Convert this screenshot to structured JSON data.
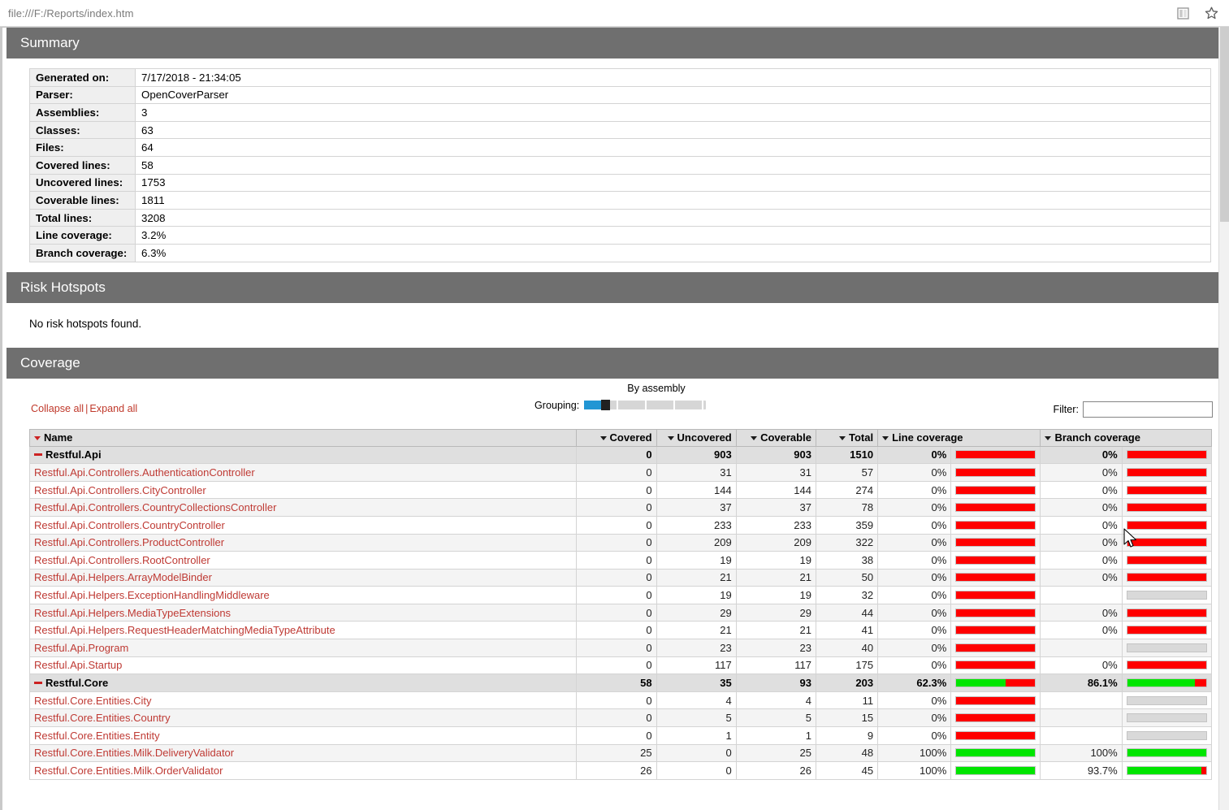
{
  "browser": {
    "url": "file:///F:/Reports/index.htm",
    "icons": [
      {
        "name": "reading-view-icon",
        "label": "Reading view"
      },
      {
        "name": "favorites-star-icon",
        "label": "Add to favorites"
      }
    ]
  },
  "sections": {
    "summary_title": "Summary",
    "risk_title": "Risk Hotspots",
    "coverage_title": "Coverage"
  },
  "summary": {
    "rows": [
      {
        "label": "Generated on:",
        "value": "7/17/2018 - 21:34:05"
      },
      {
        "label": "Parser:",
        "value": "OpenCoverParser"
      },
      {
        "label": "Assemblies:",
        "value": "3"
      },
      {
        "label": "Classes:",
        "value": "63"
      },
      {
        "label": "Files:",
        "value": "64"
      },
      {
        "label": "Covered lines:",
        "value": "58"
      },
      {
        "label": "Uncovered lines:",
        "value": "1753"
      },
      {
        "label": "Coverable lines:",
        "value": "1811"
      },
      {
        "label": "Total lines:",
        "value": "3208"
      },
      {
        "label": "Line coverage:",
        "value": "3.2%"
      },
      {
        "label": "Branch coverage:",
        "value": "6.3%"
      }
    ]
  },
  "risk_hotspots": {
    "message": "No risk hotspots found."
  },
  "coverage_controls": {
    "collapse_all": "Collapse all",
    "separator": "|",
    "expand_all": "Expand all",
    "grouping_title": "By assembly",
    "grouping_label": "Grouping:",
    "grouping_value": 1,
    "filter_label": "Filter:",
    "filter_value": "",
    "filter_placeholder": ""
  },
  "coverage_table": {
    "headers": {
      "name": "Name",
      "covered": "Covered",
      "uncovered": "Uncovered",
      "coverable": "Coverable",
      "total": "Total",
      "line_coverage": "Line coverage",
      "branch_coverage": "Branch coverage"
    },
    "rows": [
      {
        "type": "group",
        "name": "Restful.Api",
        "covered": "0",
        "uncovered": "903",
        "coverable": "903",
        "total": "1510",
        "line_pct": "0%",
        "line_val": 0,
        "branch_pct": "0%",
        "branch_val": 0
      },
      {
        "type": "item",
        "name": "Restful.Api.Controllers.AuthenticationController",
        "covered": "0",
        "uncovered": "31",
        "coverable": "31",
        "total": "57",
        "line_pct": "0%",
        "line_val": 0,
        "branch_pct": "0%",
        "branch_val": 0
      },
      {
        "type": "item",
        "name": "Restful.Api.Controllers.CityController",
        "covered": "0",
        "uncovered": "144",
        "coverable": "144",
        "total": "274",
        "line_pct": "0%",
        "line_val": 0,
        "branch_pct": "0%",
        "branch_val": 0
      },
      {
        "type": "item",
        "name": "Restful.Api.Controllers.CountryCollectionsController",
        "covered": "0",
        "uncovered": "37",
        "coverable": "37",
        "total": "78",
        "line_pct": "0%",
        "line_val": 0,
        "branch_pct": "0%",
        "branch_val": 0
      },
      {
        "type": "item",
        "name": "Restful.Api.Controllers.CountryController",
        "covered": "0",
        "uncovered": "233",
        "coverable": "233",
        "total": "359",
        "line_pct": "0%",
        "line_val": 0,
        "branch_pct": "0%",
        "branch_val": 0
      },
      {
        "type": "item",
        "name": "Restful.Api.Controllers.ProductController",
        "covered": "0",
        "uncovered": "209",
        "coverable": "209",
        "total": "322",
        "line_pct": "0%",
        "line_val": 0,
        "branch_pct": "0%",
        "branch_val": 0
      },
      {
        "type": "item",
        "name": "Restful.Api.Controllers.RootController",
        "covered": "0",
        "uncovered": "19",
        "coverable": "19",
        "total": "38",
        "line_pct": "0%",
        "line_val": 0,
        "branch_pct": "0%",
        "branch_val": 0
      },
      {
        "type": "item",
        "name": "Restful.Api.Helpers.ArrayModelBinder",
        "covered": "0",
        "uncovered": "21",
        "coverable": "21",
        "total": "50",
        "line_pct": "0%",
        "line_val": 0,
        "branch_pct": "0%",
        "branch_val": 0
      },
      {
        "type": "item",
        "name": "Restful.Api.Helpers.ExceptionHandlingMiddleware",
        "covered": "0",
        "uncovered": "19",
        "coverable": "19",
        "total": "32",
        "line_pct": "0%",
        "line_val": 0,
        "branch_pct": "",
        "branch_val": null
      },
      {
        "type": "item",
        "name": "Restful.Api.Helpers.MediaTypeExtensions",
        "covered": "0",
        "uncovered": "29",
        "coverable": "29",
        "total": "44",
        "line_pct": "0%",
        "line_val": 0,
        "branch_pct": "0%",
        "branch_val": 0
      },
      {
        "type": "item",
        "name": "Restful.Api.Helpers.RequestHeaderMatchingMediaTypeAttribute",
        "covered": "0",
        "uncovered": "21",
        "coverable": "21",
        "total": "41",
        "line_pct": "0%",
        "line_val": 0,
        "branch_pct": "0%",
        "branch_val": 0
      },
      {
        "type": "item",
        "name": "Restful.Api.Program",
        "covered": "0",
        "uncovered": "23",
        "coverable": "23",
        "total": "40",
        "line_pct": "0%",
        "line_val": 0,
        "branch_pct": "",
        "branch_val": null
      },
      {
        "type": "item",
        "name": "Restful.Api.Startup",
        "covered": "0",
        "uncovered": "117",
        "coverable": "117",
        "total": "175",
        "line_pct": "0%",
        "line_val": 0,
        "branch_pct": "0%",
        "branch_val": 0
      },
      {
        "type": "group",
        "name": "Restful.Core",
        "covered": "58",
        "uncovered": "35",
        "coverable": "93",
        "total": "203",
        "line_pct": "62.3%",
        "line_val": 62.3,
        "branch_pct": "86.1%",
        "branch_val": 86.1
      },
      {
        "type": "item",
        "name": "Restful.Core.Entities.City",
        "covered": "0",
        "uncovered": "4",
        "coverable": "4",
        "total": "11",
        "line_pct": "0%",
        "line_val": 0,
        "branch_pct": "",
        "branch_val": null
      },
      {
        "type": "item",
        "name": "Restful.Core.Entities.Country",
        "covered": "0",
        "uncovered": "5",
        "coverable": "5",
        "total": "15",
        "line_pct": "0%",
        "line_val": 0,
        "branch_pct": "",
        "branch_val": null
      },
      {
        "type": "item",
        "name": "Restful.Core.Entities.Entity",
        "covered": "0",
        "uncovered": "1",
        "coverable": "1",
        "total": "9",
        "line_pct": "0%",
        "line_val": 0,
        "branch_pct": "",
        "branch_val": null
      },
      {
        "type": "item",
        "name": "Restful.Core.Entities.Milk.DeliveryValidator",
        "covered": "25",
        "uncovered": "0",
        "coverable": "25",
        "total": "48",
        "line_pct": "100%",
        "line_val": 100,
        "branch_pct": "100%",
        "branch_val": 100
      },
      {
        "type": "item",
        "name": "Restful.Core.Entities.Milk.OrderValidator",
        "covered": "26",
        "uncovered": "0",
        "coverable": "26",
        "total": "45",
        "line_pct": "100%",
        "line_val": 100,
        "branch_pct": "93.7%",
        "branch_val": 93.7
      }
    ]
  },
  "colors": {
    "header_bar": "#6f6f6f",
    "link_red": "#bf3a34",
    "bar_green": "#00e500",
    "bar_red": "#ff0000",
    "bar_empty": "#d9d9d9",
    "slider_blue": "#2196d4"
  }
}
